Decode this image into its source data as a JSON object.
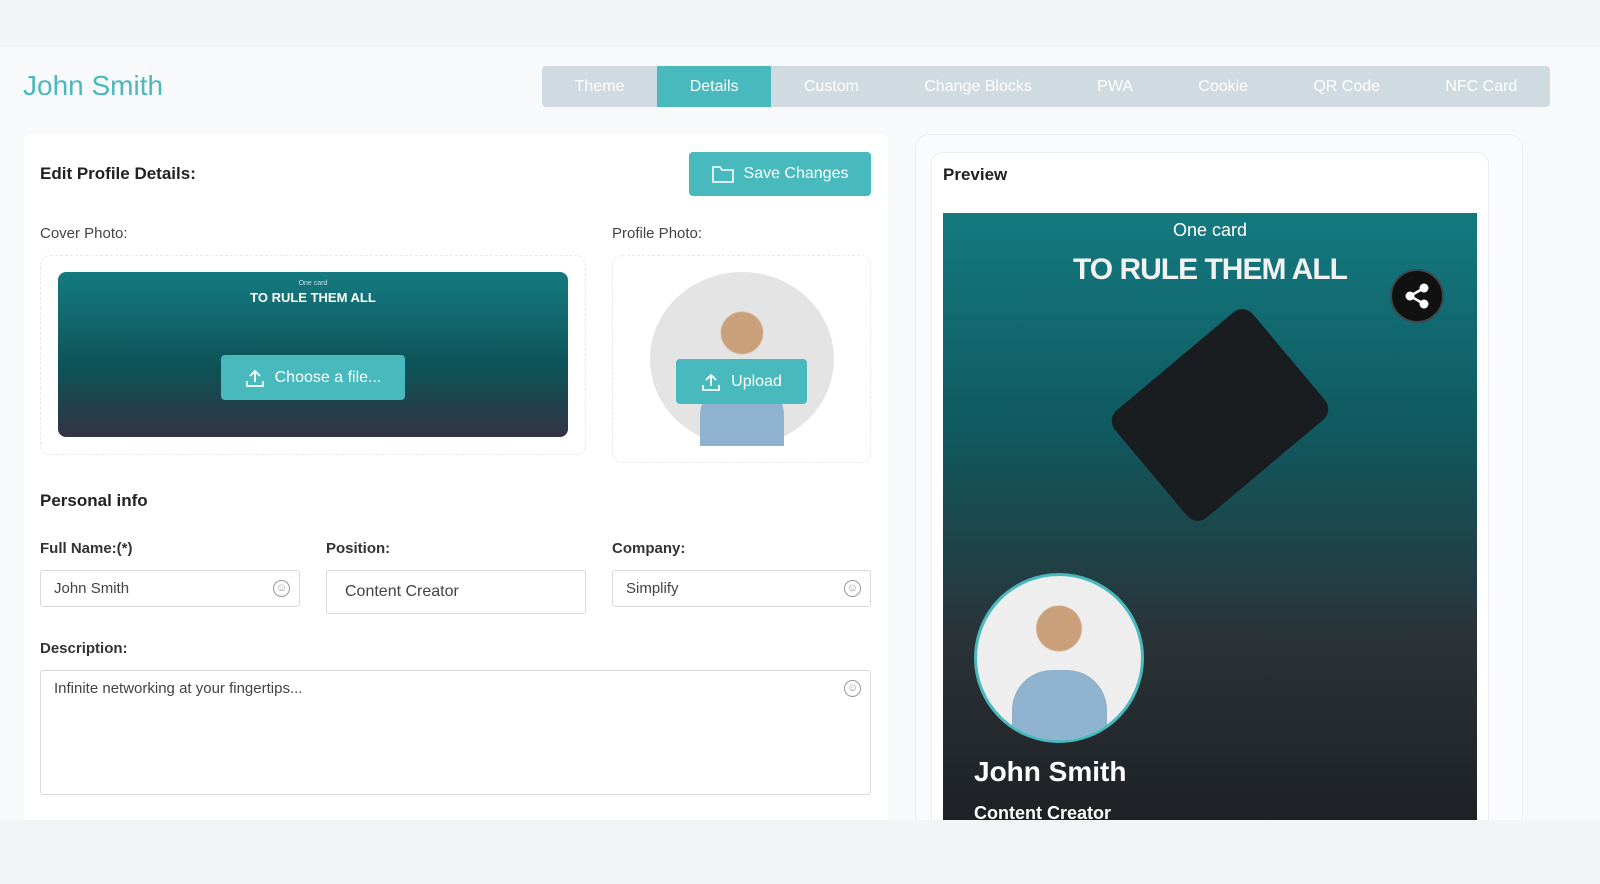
{
  "header": {
    "title": "John Smith"
  },
  "tabs": [
    {
      "label": "Theme"
    },
    {
      "label": "Details"
    },
    {
      "label": "Custom"
    },
    {
      "label": "Change Blocks"
    },
    {
      "label": "PWA"
    },
    {
      "label": "Cookie"
    },
    {
      "label": "QR Code"
    },
    {
      "label": "NFC Card"
    }
  ],
  "active_tab": "Details",
  "editor": {
    "heading": "Edit Profile Details:",
    "save_label": "Save Changes",
    "cover_label": "Cover Photo:",
    "profile_label": "Profile Photo:",
    "cover_text_small": "One card",
    "cover_text_big": "TO RULE THEM ALL",
    "choose_file_label": "Choose a file...",
    "upload_label": "Upload",
    "personal_heading": "Personal info",
    "full_name_label": "Full Name:(*)",
    "full_name_value": "John Smith",
    "position_label": "Position:",
    "position_value": "Content Creator",
    "company_label": "Company:",
    "company_value": "Simplify",
    "description_label": "Description:",
    "description_value": "Infinite networking at your fingertips..."
  },
  "preview": {
    "heading": "Preview",
    "banner_small": "One card",
    "banner_big": "TO RULE THEM ALL",
    "name": "John Smith",
    "position": "Content Creator"
  },
  "colors": {
    "accent": "#48b9bd",
    "tabs_bg": "#cfdae1"
  }
}
